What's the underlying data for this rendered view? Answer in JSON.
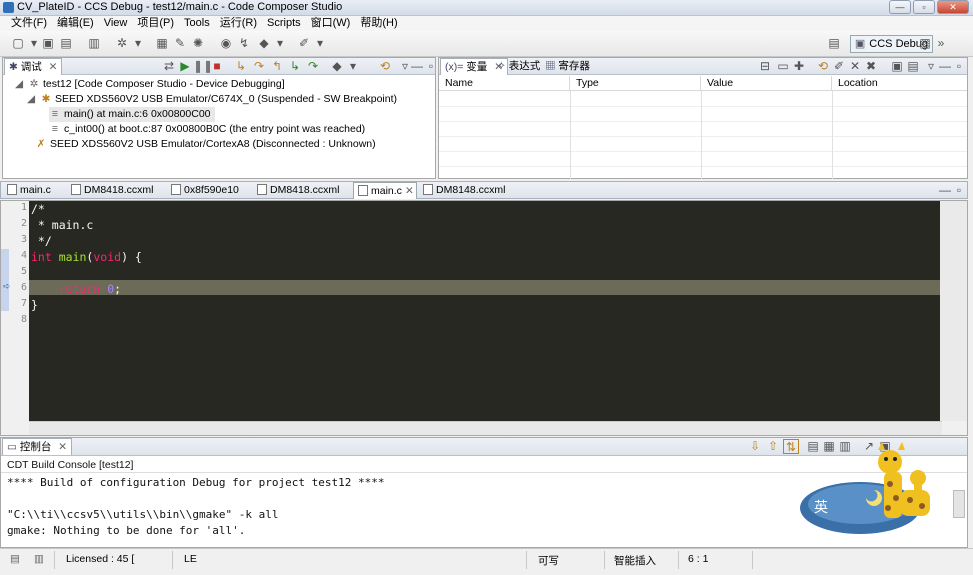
{
  "window": {
    "title": "CV_PlateID  -  CCS Debug - test12/main.c - Code Composer Studio"
  },
  "menubar": [
    "文件(F)",
    "编辑(E)",
    "View",
    "项目(P)",
    "Tools",
    "运行(R)",
    "Scripts",
    "窗口(W)",
    "帮助(H)"
  ],
  "perspective": {
    "label": "CCS Debug"
  },
  "debug_view": {
    "tab_label": "调试",
    "items": [
      {
        "text": "test12 [Code Composer Studio - Device Debugging]",
        "icon": "debug-session-icon"
      },
      {
        "text": "SEED XDS560V2 USB Emulator/C674X_0 (Suspended - SW Breakpoint)",
        "icon": "cpu-suspended-icon"
      },
      {
        "text": "main() at main.c:6 0x00800C00",
        "icon": "stack-frame-icon"
      },
      {
        "text": "c_int00() at boot.c:87 0x00800B0C  (the entry point was reached)",
        "icon": "stack-frame-icon"
      },
      {
        "text": "SEED XDS560V2 USB Emulator/CortexA8 (Disconnected : Unknown)",
        "icon": "cpu-disconnected-icon"
      }
    ]
  },
  "vars_view": {
    "tabs": [
      "变量",
      "表达式",
      "寄存器"
    ],
    "columns": [
      "Name",
      "Type",
      "Value",
      "Location"
    ]
  },
  "editor": {
    "tabs": [
      {
        "label": "main.c",
        "active": false
      },
      {
        "label": "DM8418.ccxml",
        "active": false
      },
      {
        "label": "0x8f590e10",
        "active": false
      },
      {
        "label": "DM8418.ccxml",
        "active": false
      },
      {
        "label": "main.c",
        "active": true
      },
      {
        "label": "DM8148.ccxml",
        "active": false
      }
    ],
    "line_numbers": [
      "1",
      "2",
      "3",
      "4",
      "5",
      "6",
      "7",
      "8"
    ]
  },
  "console": {
    "tab_label": "控制台",
    "subtitle": "CDT Build Console [test12]",
    "lines": [
      "**** Build of configuration Debug for project test12 ****",
      "",
      "\"C:\\\\ti\\\\ccsv5\\\\utils\\\\bin\\\\gmake\" -k all",
      "gmake: Nothing to be done for 'all'."
    ]
  },
  "statusbar": {
    "licensed": "Licensed : 45 [",
    "encoding": "LE",
    "writable": "可写",
    "insert_mode": "智能插入",
    "position": "6 : 1"
  },
  "mascot": {
    "badge_text": "英"
  }
}
